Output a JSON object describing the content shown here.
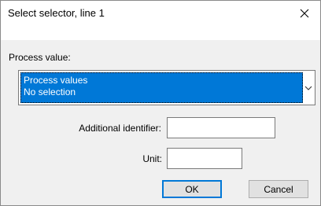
{
  "window": {
    "title": "Select selector, line 1"
  },
  "labels": {
    "process_value": "Process value:",
    "additional_identifier": "Additional identifier:",
    "unit": "Unit:"
  },
  "process_combo": {
    "line1": "Process values",
    "line2": "No selection"
  },
  "fields": {
    "additional_identifier_value": "",
    "unit_value": ""
  },
  "buttons": {
    "ok": "OK",
    "cancel": "Cancel"
  },
  "icons": {
    "close": "close-icon",
    "dropdown": "chevron-down-icon"
  },
  "colors": {
    "selection": "#0078d7",
    "default_button_border": "#0078d7"
  }
}
